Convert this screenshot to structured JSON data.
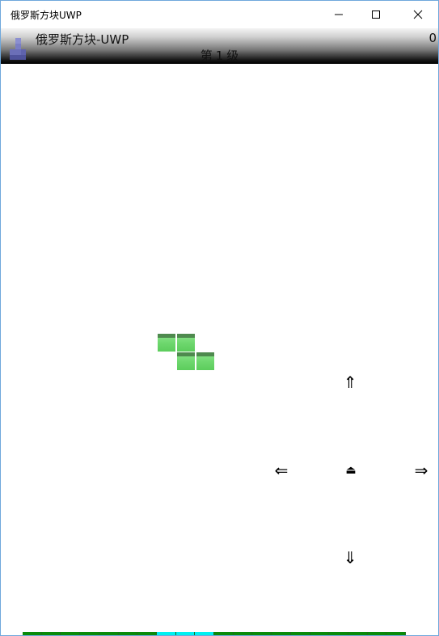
{
  "window": {
    "title": "俄罗斯方块UWP",
    "minimize_icon": "minimize-icon",
    "maximize_icon": "maximize-icon",
    "close_icon": "close-icon"
  },
  "header": {
    "app_name": "俄罗斯方块-UWP",
    "score": "0",
    "level_prefix": "第",
    "level_value": "1",
    "level_suffix": "级",
    "logo_icon": "tetris-logo-icon"
  },
  "board": {
    "piece_color": "#6fd86f",
    "piece_shape": "Z"
  },
  "controls": {
    "up": "⇑",
    "left": "⇐",
    "rotate": "⏏",
    "right": "⇒",
    "down": "⇓"
  },
  "strip": {
    "colors": {
      "filled": "#0a8a0a",
      "highlight": "#00f0f0"
    },
    "segments": [
      "filled",
      "filled",
      "filled",
      "filled",
      "filled",
      "filled",
      "filled",
      "highlight",
      "highlight",
      "highlight",
      "filled",
      "filled",
      "filled",
      "filled",
      "filled",
      "filled",
      "filled",
      "filled",
      "filled",
      "filled"
    ]
  }
}
